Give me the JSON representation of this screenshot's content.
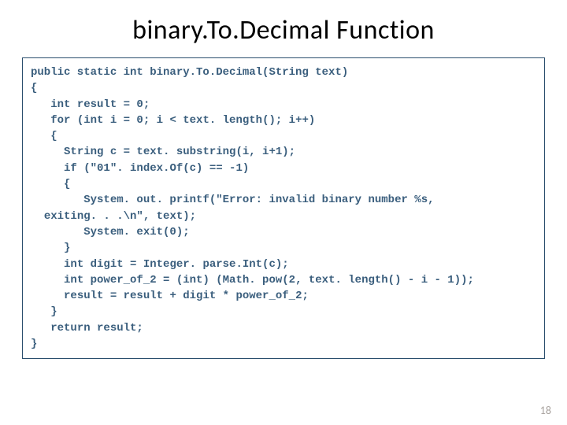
{
  "title": "binary.To.Decimal Function",
  "code": "public static int binary.To.Decimal(String text)\n{\n   int result = 0;\n   for (int i = 0; i < text. length(); i++)\n   {\n     String c = text. substring(i, i+1);\n     if (\"01\". index.Of(c) == -1)\n     {\n        System. out. printf(\"Error: invalid binary number %s,\n  exiting. . .\\n\", text);\n        System. exit(0);\n     }\n     int digit = Integer. parse.Int(c);\n     int power_of_2 = (int) (Math. pow(2, text. length() - i - 1));\n     result = result + digit * power_of_2;\n   }\n   return result;\n}",
  "page_number": "18"
}
